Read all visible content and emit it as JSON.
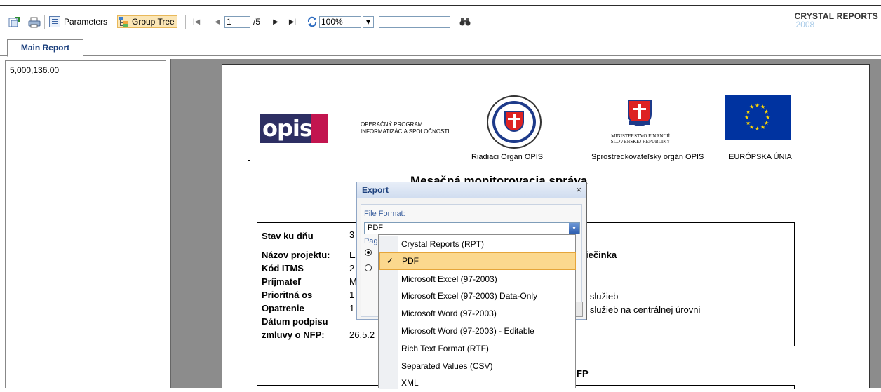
{
  "toolbar": {
    "parameters_label": "Parameters",
    "group_tree_label": "Group Tree",
    "current_page": "1",
    "total_pages": "/5",
    "zoom": "100%",
    "search_value": ""
  },
  "brand": {
    "name": "CRYSTAL REPORTS",
    "version": "2008"
  },
  "tabs": [
    {
      "label": "Main Report"
    }
  ],
  "group_tree": {
    "items": [
      "5,000,136.00"
    ]
  },
  "report": {
    "logo_text": "opis",
    "opis_line1": "OPERAČNÝ PROGRAM",
    "opis_line2": "INFORMATIZÁCIA SPOLOČNOSTI",
    "ministry_line1": "MINISTERSTVO FINANCIÍ",
    "ministry_line2": "SLOVENSKEJ REPUBLIKY",
    "caption_riadiaci": "Riadiaci Orgán OPIS",
    "caption_sprostredkovatel": "Sprostredkovateľský orgán OPIS",
    "caption_eu": "EURÓPSKA ÚNIA",
    "title_visible": "Mesačná monitorovacia správa",
    "fields": [
      {
        "label": "Stav ku dňu",
        "value": "3"
      },
      {
        "label": "Názov projektu:",
        "value": "E",
        "extra": "priečinka"
      },
      {
        "label": "Kód ITMS",
        "value": "2"
      },
      {
        "label": "Príjmateľ",
        "value": "M"
      },
      {
        "label": "Prioritná os",
        "value": "1",
        "extra": "ých služieb"
      },
      {
        "label": "Opatrenie",
        "value": "1",
        "extra": "ých služieb na centrálnej úrovni"
      },
      {
        "label": "Dátum podpisu",
        "value": ""
      },
      {
        "label": "zmluvy o NFP:",
        "value": "26.5.2"
      }
    ],
    "section2_fragment": "FP"
  },
  "export_dialog": {
    "title": "Export",
    "file_format_label": "File Format:",
    "selected_format": "PDF",
    "page_range_label": "Pag",
    "close_glyph": "×"
  },
  "format_options": [
    {
      "label": "Crystal Reports (RPT)",
      "checked": false
    },
    {
      "label": "PDF",
      "checked": true
    },
    {
      "label": "Microsoft Excel (97-2003)",
      "checked": false
    },
    {
      "label": "Microsoft Excel (97-2003) Data-Only",
      "checked": false
    },
    {
      "label": "Microsoft Word (97-2003)",
      "checked": false
    },
    {
      "label": "Microsoft Word (97-2003) - Editable",
      "checked": false
    },
    {
      "label": "Rich Text Format (RTF)",
      "checked": false
    },
    {
      "label": "Separated Values (CSV)",
      "checked": false
    },
    {
      "label": "XML",
      "checked": false
    }
  ],
  "colors": {
    "accent": "#1b3f7c",
    "highlight": "#fbd88e",
    "highlight_border": "#e5a53a",
    "opis_dark": "#2d2f63",
    "opis_red": "#c2154f",
    "eu_blue": "#0033a0",
    "eu_star": "#ffd700"
  },
  "icons": [
    "export-icon",
    "print-icon",
    "parameters-icon",
    "group-tree-icon",
    "first-page-icon",
    "prev-page-icon",
    "next-page-icon",
    "last-page-icon",
    "refresh-icon",
    "zoom-dropdown-icon",
    "binoculars-icon",
    "check-icon",
    "chevron-down-icon",
    "close-icon"
  ]
}
